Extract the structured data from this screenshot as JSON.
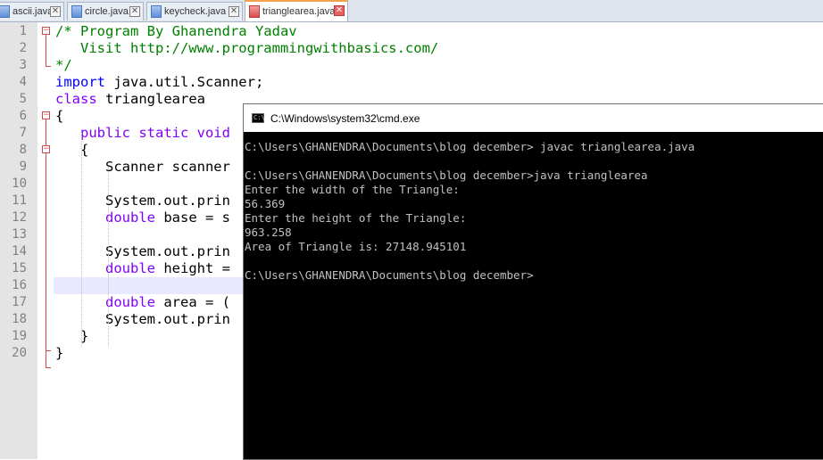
{
  "tabs": [
    {
      "label": "ascii.java",
      "active": false
    },
    {
      "label": "circle.java",
      "active": false
    },
    {
      "label": "keycheck.java",
      "active": false
    },
    {
      "label": "trianglearea.java",
      "active": true
    }
  ],
  "editor": {
    "line_numbers": [
      "1",
      "2",
      "3",
      "4",
      "5",
      "6",
      "7",
      "8",
      "9",
      "10",
      "11",
      "12",
      "13",
      "14",
      "15",
      "16",
      "17",
      "18",
      "19",
      "20"
    ],
    "lines": [
      {
        "segments": [
          {
            "t": "/* Program By Ghanendra Yadav",
            "c": "cmt"
          }
        ]
      },
      {
        "segments": [
          {
            "t": "   Visit http://www.programmingwithbasics.com/",
            "c": "cmt"
          }
        ]
      },
      {
        "segments": [
          {
            "t": "*/",
            "c": "cmt"
          }
        ]
      },
      {
        "segments": [
          {
            "t": "import",
            "c": "kw"
          },
          {
            "t": " java.util.Scanner;",
            "c": ""
          }
        ]
      },
      {
        "segments": [
          {
            "t": "class",
            "c": "kw2"
          },
          {
            "t": " trianglearea",
            "c": ""
          }
        ]
      },
      {
        "segments": [
          {
            "t": "{",
            "c": ""
          }
        ]
      },
      {
        "segments": [
          {
            "t": "   ",
            "c": ""
          },
          {
            "t": "public static void",
            "c": "kw2"
          }
        ]
      },
      {
        "segments": [
          {
            "t": "   {",
            "c": ""
          }
        ]
      },
      {
        "segments": [
          {
            "t": "      Scanner scanner",
            "c": ""
          }
        ]
      },
      {
        "segments": []
      },
      {
        "segments": [
          {
            "t": "      System.out.prin",
            "c": ""
          }
        ]
      },
      {
        "segments": [
          {
            "t": "      ",
            "c": ""
          },
          {
            "t": "double",
            "c": "kw2"
          },
          {
            "t": " base = s",
            "c": ""
          }
        ]
      },
      {
        "segments": []
      },
      {
        "segments": [
          {
            "t": "      System.out.prin",
            "c": ""
          }
        ]
      },
      {
        "segments": [
          {
            "t": "      ",
            "c": ""
          },
          {
            "t": "double",
            "c": "kw2"
          },
          {
            "t": " height =",
            "c": ""
          }
        ]
      },
      {
        "segments": []
      },
      {
        "segments": [
          {
            "t": "      ",
            "c": ""
          },
          {
            "t": "double",
            "c": "kw2"
          },
          {
            "t": " area = (",
            "c": ""
          }
        ]
      },
      {
        "segments": [
          {
            "t": "      System.out.prin",
            "c": ""
          }
        ]
      },
      {
        "segments": [
          {
            "t": "   }",
            "c": ""
          }
        ]
      },
      {
        "segments": [
          {
            "t": "}",
            "c": ""
          }
        ]
      }
    ],
    "highlighted_line": 16
  },
  "cmd": {
    "title": "C:\\Windows\\system32\\cmd.exe",
    "lines": [
      "C:\\Users\\GHANENDRA\\Documents\\blog december> javac trianglearea.java",
      "",
      "C:\\Users\\GHANENDRA\\Documents\\blog december>java trianglearea",
      "Enter the width of the Triangle:",
      "56.369",
      "Enter the height of the Triangle:",
      "963.258",
      "Area of Triangle is: 27148.945101",
      "",
      "C:\\Users\\GHANENDRA\\Documents\\blog december>"
    ]
  },
  "colors": {
    "comment": "#008000",
    "keyword": "#0000ff",
    "type_keyword": "#8000ff",
    "active_tab_accent": "#f2a24a"
  }
}
